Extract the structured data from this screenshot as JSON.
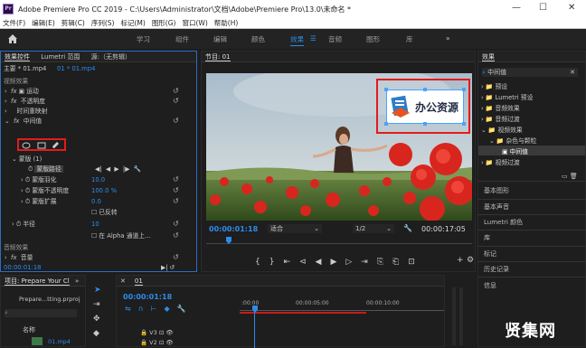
{
  "titlebar": {
    "icon": "Pr",
    "title": "Adobe Premiere Pro CC 2019 - C:\\Users\\Administrator\\文档\\Adobe\\Premiere Pro\\13.0\\未命名 *",
    "minimize": "—",
    "maximize": "☐",
    "close": "✕"
  },
  "menu": [
    "文件(F)",
    "编辑(E)",
    "剪辑(C)",
    "序列(S)",
    "标记(M)",
    "图形(G)",
    "窗口(W)",
    "帮助(H)"
  ],
  "workspaces": [
    "学习",
    "组件",
    "编辑",
    "颜色",
    "效果",
    "音频",
    "图形",
    "库"
  ],
  "workspace_active": "效果",
  "workspace_more": "»",
  "effect_controls": {
    "tabs": [
      "效果控件",
      "Lumetri 范围",
      "源:（无剪辑）"
    ],
    "clip_tabs": [
      "主要 * 01.mp4",
      "01 * 01.mp4"
    ],
    "section_video": "视频效果",
    "items": [
      "运动",
      "不透明度",
      "时间重映射",
      "中间值"
    ],
    "mask_label": "蒙版 (1)",
    "mask_path": "蒙版路径",
    "mask_feather_label": "蒙版羽化",
    "mask_feather_value": "10.0",
    "mask_opacity_label": "蒙版不透明度",
    "mask_opacity_value": "100.0 %",
    "mask_expansion_label": "蒙版扩展",
    "mask_expansion_value": "0.0",
    "inverted": "已反转",
    "radius_label": "半径",
    "radius_value": "10",
    "alpha_label": "在 Alpha 通道上...",
    "section_audio": "音频效果",
    "audio_item": "音量",
    "timecode": "00:00:01:18",
    "playback_controls": "◀ ◀ ▶ ▶|"
  },
  "monitor": {
    "tab": "节目: 01",
    "timecode": "00:00:01:18",
    "fit": "适合",
    "quality": "1/2",
    "duration": "00:00:17:05",
    "overlay_text": "办公资源",
    "controls": "{  }  |◀  ◀|  ◀  ▶  |▶  ▶|"
  },
  "project": {
    "tab": "项目: Prepare Your Cl",
    "more": "»",
    "file": "Prepare...tting.prproj",
    "name_col": "名称",
    "item": "01.mp4"
  },
  "timeline": {
    "tab": "01",
    "timecode": "00:00:01:18",
    "marks": [
      ":00:00",
      "00:00:05:00",
      "00:00:10:00"
    ],
    "tracks": [
      "V3",
      "V2"
    ]
  },
  "effects_panel": {
    "tab": "效果",
    "search_value": "中间值",
    "tree": [
      "预设",
      "Lumetri 预设",
      "音频效果",
      "音频过渡",
      "视频效果",
      "杂色与颗粒",
      "中间值",
      "视频过渡"
    ],
    "sections": [
      "基本图形",
      "基本声音",
      "Lumetri 颜色",
      "库",
      "标记",
      "历史记录",
      "信息"
    ]
  },
  "watermark": "贤集网"
}
